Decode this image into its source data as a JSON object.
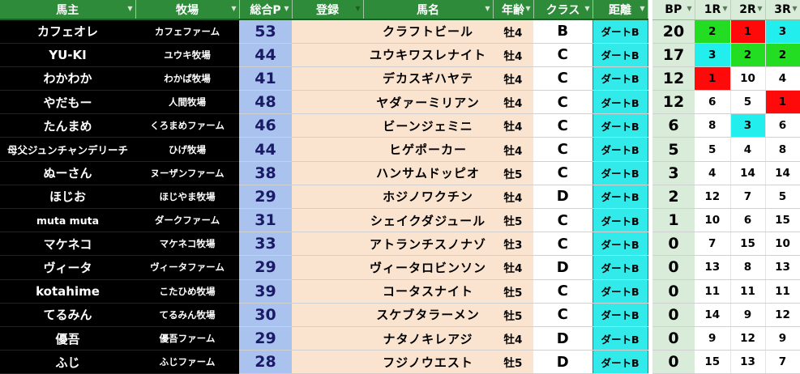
{
  "headers": {
    "owner": "馬主",
    "farm": "牧場",
    "total": "総合P",
    "reg": "登録",
    "horse": "馬名",
    "age": "年齢",
    "class": "クラス",
    "dist": "距離",
    "bp": "BP",
    "r1": "1R",
    "r2": "2R",
    "r3": "3R"
  },
  "filter_icon": "filter-dropdown-icon",
  "colors": {
    "win": "#ff0a0a",
    "second": "#22dd22",
    "third": "#22eeee",
    "header": "#2e8b3a"
  },
  "rows": [
    {
      "owner": "カフェオレ",
      "farm": "カフェファーム",
      "total": "53",
      "horse": "クラフトビール",
      "age": "牡4",
      "class": "B",
      "dist": "ダートB",
      "bp": "20",
      "r1": "2",
      "r2": "1",
      "r3": "3"
    },
    {
      "owner": "YU-KI",
      "farm": "ユウキ牧場",
      "total": "44",
      "horse": "ユウキワスレナイト",
      "age": "牡4",
      "class": "C",
      "dist": "ダートB",
      "bp": "17",
      "r1": "3",
      "r2": "2",
      "r3": "2"
    },
    {
      "owner": "わかわか",
      "farm": "わかば牧場",
      "total": "41",
      "horse": "デカスギハヤテ",
      "age": "牡4",
      "class": "C",
      "dist": "ダートB",
      "bp": "12",
      "r1": "1",
      "r2": "10",
      "r3": "4"
    },
    {
      "owner": "やだもー",
      "farm": "人間牧場",
      "total": "48",
      "horse": "ヤダァーミリアン",
      "age": "牡4",
      "class": "C",
      "dist": "ダートB",
      "bp": "12",
      "r1": "6",
      "r2": "5",
      "r3": "1"
    },
    {
      "owner": "たんまめ",
      "farm": "くろまめファーム",
      "total": "46",
      "horse": "ビーンジェミニ",
      "age": "牡4",
      "class": "C",
      "dist": "ダートB",
      "bp": "6",
      "r1": "8",
      "r2": "3",
      "r3": "6"
    },
    {
      "owner": "母父ジュンチャンデリーチ",
      "farm": "ひげ牧場",
      "total": "44",
      "horse": "ヒゲポーカー",
      "age": "牡4",
      "class": "C",
      "dist": "ダートB",
      "bp": "5",
      "r1": "5",
      "r2": "4",
      "r3": "8"
    },
    {
      "owner": "ぬーさん",
      "farm": "ヌーザンファーム",
      "total": "38",
      "horse": "ハンサムドッピオ",
      "age": "牡5",
      "class": "C",
      "dist": "ダートB",
      "bp": "3",
      "r1": "4",
      "r2": "14",
      "r3": "14"
    },
    {
      "owner": "ほじお",
      "farm": "ほじやま牧場",
      "total": "29",
      "horse": "ホジノワクチン",
      "age": "牡4",
      "class": "D",
      "dist": "ダートB",
      "bp": "2",
      "r1": "12",
      "r2": "7",
      "r3": "5"
    },
    {
      "owner": "muta muta",
      "farm": "ダークファーム",
      "total": "31",
      "horse": "シェイクダジュール",
      "age": "牡5",
      "class": "C",
      "dist": "ダートB",
      "bp": "1",
      "r1": "10",
      "r2": "6",
      "r3": "15"
    },
    {
      "owner": "マケネコ",
      "farm": "マケネコ牧場",
      "total": "33",
      "horse": "アトランチスノナゾ",
      "age": "牡3",
      "class": "C",
      "dist": "ダートB",
      "bp": "0",
      "r1": "7",
      "r2": "15",
      "r3": "10"
    },
    {
      "owner": "ヴィータ",
      "farm": "ヴィータファーム",
      "total": "29",
      "horse": "ヴィータロビンソン",
      "age": "牡4",
      "class": "D",
      "dist": "ダートB",
      "bp": "0",
      "r1": "13",
      "r2": "8",
      "r3": "13"
    },
    {
      "owner": "kotahime",
      "farm": "こたひめ牧場",
      "total": "39",
      "horse": "コータスナイト",
      "age": "牡5",
      "class": "C",
      "dist": "ダートB",
      "bp": "0",
      "r1": "11",
      "r2": "11",
      "r3": "11"
    },
    {
      "owner": "てるみん",
      "farm": "てるみん牧場",
      "total": "30",
      "horse": "スケブタラーメン",
      "age": "牡5",
      "class": "C",
      "dist": "ダートB",
      "bp": "0",
      "r1": "14",
      "r2": "9",
      "r3": "12"
    },
    {
      "owner": "優吾",
      "farm": "優吾ファーム",
      "total": "29",
      "horse": "ナタノキレアジ",
      "age": "牡4",
      "class": "D",
      "dist": "ダートB",
      "bp": "0",
      "r1": "9",
      "r2": "12",
      "r3": "9"
    },
    {
      "owner": "ふじ",
      "farm": "ふじファーム",
      "total": "28",
      "horse": "フジノウエスト",
      "age": "牡5",
      "class": "D",
      "dist": "ダートB",
      "bp": "0",
      "r1": "15",
      "r2": "13",
      "r3": "7"
    }
  ]
}
